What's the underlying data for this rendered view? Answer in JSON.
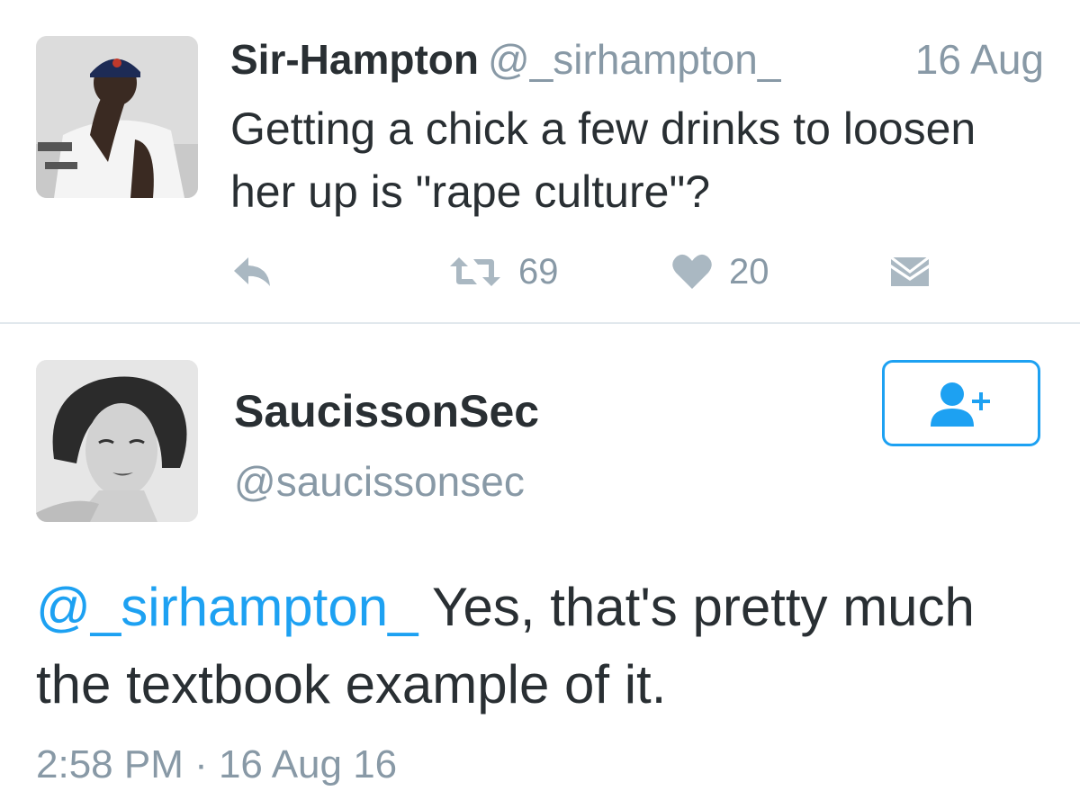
{
  "tweet1": {
    "display_name": "Sir-Hampton",
    "handle": "@_sirhampton_",
    "date": "16 Aug",
    "text": "Getting a chick a few drinks to loosen her up is \"rape culture\"?",
    "avatar_icon": "user-photo-avatar",
    "actions": {
      "reply_icon": "reply-icon",
      "retweet_icon": "retweet-icon",
      "retweet_count": "69",
      "like_icon": "heart-icon",
      "like_count": "20",
      "dm_icon": "envelope-icon"
    }
  },
  "tweet2": {
    "display_name": "SaucissonSec",
    "handle": "@saucissonsec",
    "mention": "@_sirhampton_",
    "text": " Yes, that's pretty much the textbook example of it.",
    "timestamp": "2:58 PM · 16 Aug 16",
    "avatar_icon": "user-photo-avatar",
    "follow_icon": "add-user-icon"
  },
  "colors": {
    "text_primary": "#292f33",
    "text_secondary": "#8899a6",
    "accent": "#1da1f2",
    "icon_gray": "#aab8c2",
    "divider": "#e1e8ed"
  }
}
